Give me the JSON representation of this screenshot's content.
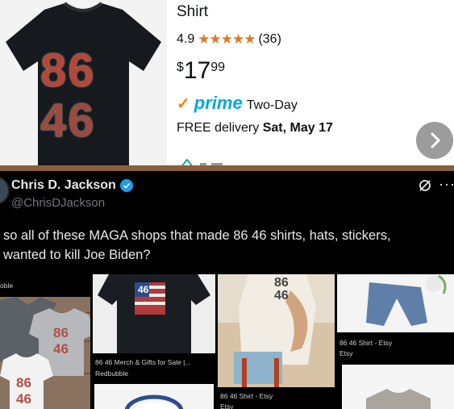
{
  "product": {
    "title": "Shirt",
    "rating": "4.9",
    "stars": "★★★★★",
    "review_count": "(36)",
    "price_currency": "$",
    "price_whole": "17",
    "price_fraction": "99",
    "prime_label": "prime",
    "prime_extra": "Two-Day",
    "delivery_prefix": "FREE delivery",
    "delivery_date": "Sat, May 17",
    "shirt_print_top": "86",
    "shirt_print_bottom": "46"
  },
  "tweet": {
    "author_name": "Chris D. Jackson",
    "author_handle": "@ChrisDJackson",
    "text_line1": "so all of these MAGA shops that made 86 46 shirts, hats, stickers,",
    "text_line2": "wanted to kill Joe Biden?"
  },
  "grid": {
    "card1_caption": "oble",
    "card2_caption": "86 46 Merch & Gifts for Sale |...",
    "card2_site": "Redbubble",
    "card3_caption": "86 46 Shirt - Etsy",
    "card3_site": "Etsy",
    "card4_caption": "86 46 Shirt - Etsy",
    "card4_site": "Etsy",
    "mug_print_top": "86",
    "mug_print_bottom": "46"
  },
  "colors": {
    "star": "#de7921",
    "prime_blue": "#00a8e1",
    "verified": "#1d9bf0",
    "divider": "#8b5e3c"
  },
  "icons": [
    "chevron-right-icon",
    "verified-badge-icon",
    "grok-icon",
    "more-icon"
  ]
}
